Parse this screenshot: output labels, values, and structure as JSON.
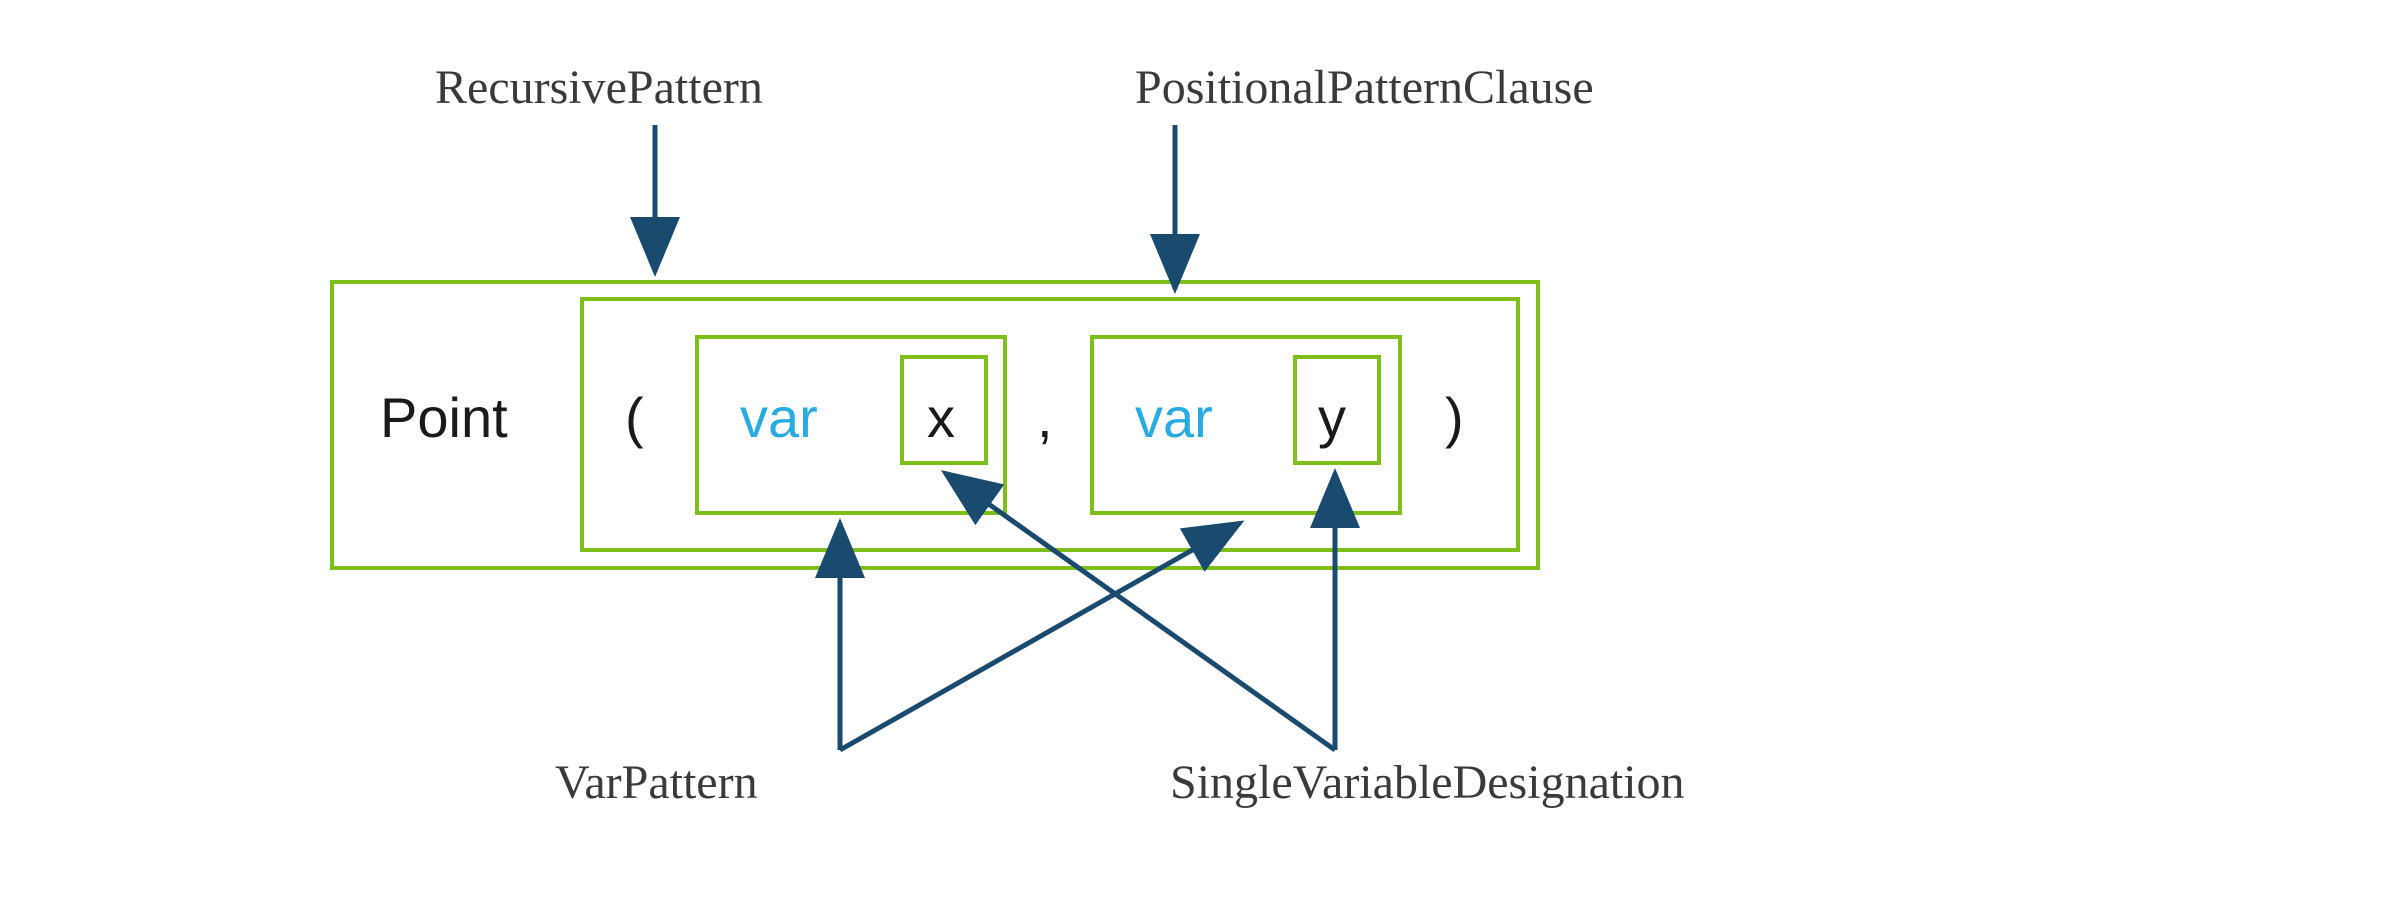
{
  "labels": {
    "top_left": "RecursivePattern",
    "top_right": "PositionalPatternClause",
    "bottom_left": "VarPattern",
    "bottom_right": "SingleVariableDesignation"
  },
  "code": {
    "type_name": "Point",
    "open_paren": "(",
    "var1": "var",
    "name1": "x",
    "comma": ",",
    "var2": "var",
    "name2": "y",
    "close_paren": ")"
  },
  "colors": {
    "box_border": "#7fbf1a",
    "arrow": "#1a4a6e",
    "label_text": "#3a3a3a",
    "code_text": "#1a1a1a",
    "keyword": "#29abe2"
  }
}
